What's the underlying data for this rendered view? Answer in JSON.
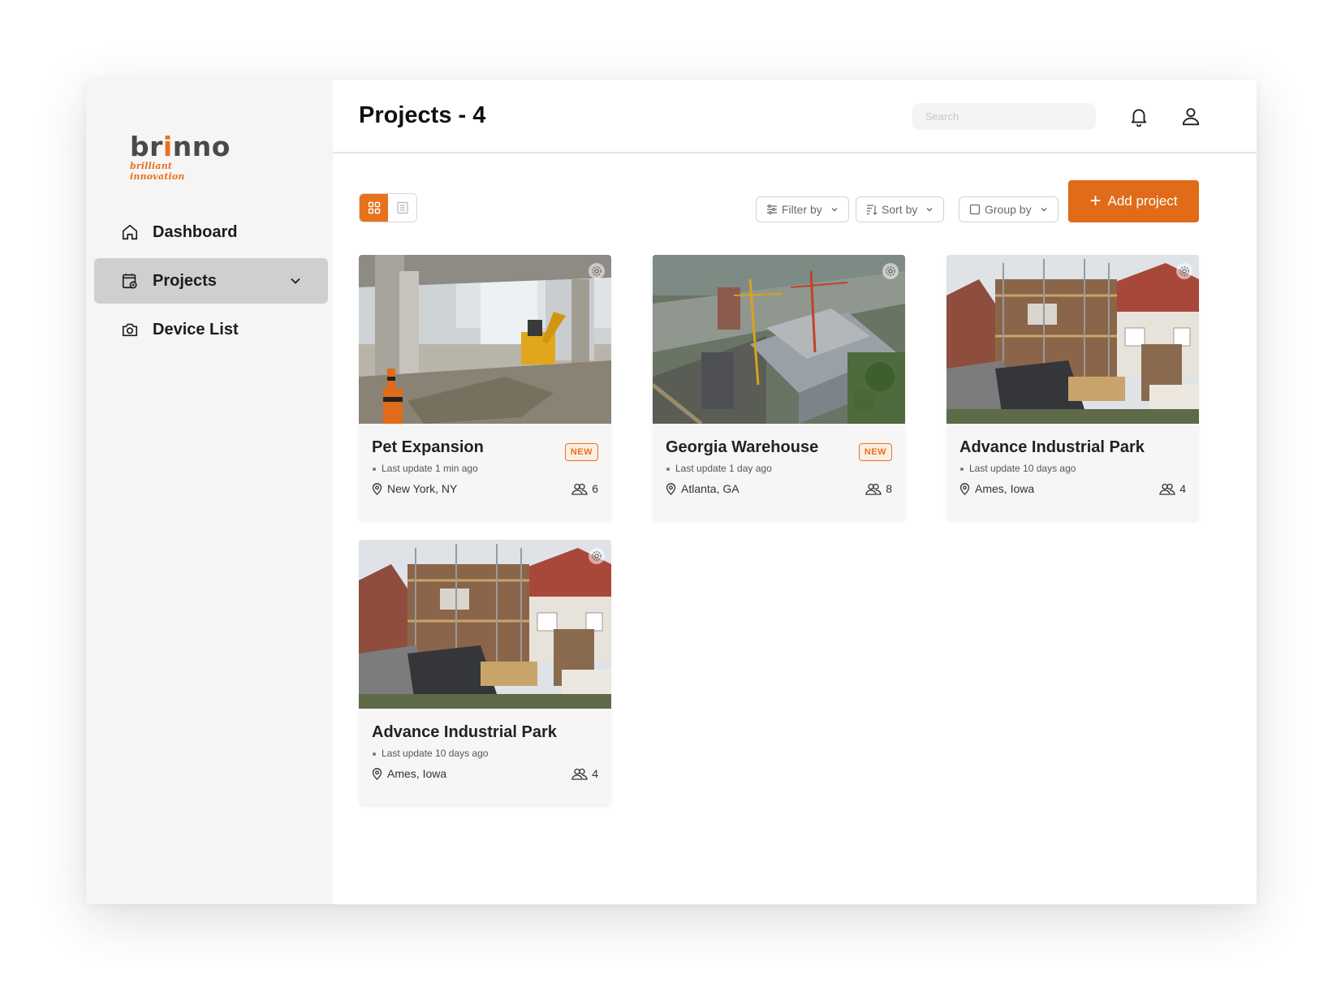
{
  "brand": {
    "name_start": "br",
    "name_accent": "i",
    "name_end": "nno",
    "tagline": "brilliant innovation",
    "accent_color": "#e8721c"
  },
  "sidebar": {
    "items": [
      {
        "label": "Dashboard",
        "icon": "home-icon"
      },
      {
        "label": "Projects",
        "icon": "projects-icon",
        "active": true,
        "expandable": true
      },
      {
        "label": "Device List",
        "icon": "camera-icon"
      }
    ]
  },
  "header": {
    "title": "Projects - 4",
    "search_placeholder": "Search",
    "icons": [
      "bell-icon",
      "user-icon"
    ]
  },
  "toolbar": {
    "view_modes": [
      "grid-view-icon",
      "list-view-icon"
    ],
    "active_view": "grid",
    "filter_label": "Filter by",
    "sort_label": "Sort by",
    "group_label": "Group by",
    "add_label": "Add project"
  },
  "projects": [
    {
      "title": "Pet Expansion",
      "badge": "NEW",
      "updated": "Last update 1 min ago",
      "location": "New York, NY",
      "members": "6"
    },
    {
      "title": "Georgia Warehouse",
      "badge": "NEW",
      "updated": "Last update 1 day ago",
      "location": "Atlanta, GA",
      "members": "8"
    },
    {
      "title": "Advance Industrial Park",
      "badge": "",
      "updated": "Last update 10 days ago",
      "location": "Ames, Iowa",
      "members": "4"
    },
    {
      "title": "Advance Industrial Park",
      "badge": "",
      "updated": "Last update 10 days ago",
      "location": "Ames, Iowa",
      "members": "4"
    }
  ]
}
